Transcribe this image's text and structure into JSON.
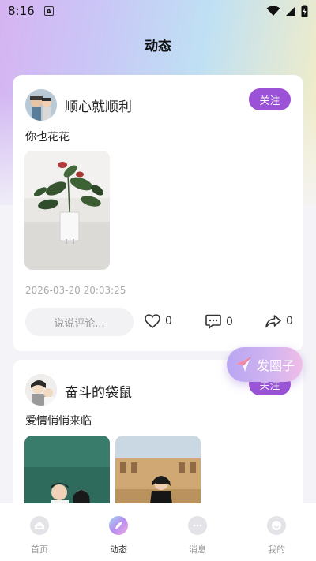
{
  "status_bar": {
    "time": "8:16",
    "indicator": "A"
  },
  "header": {
    "title": "动态"
  },
  "posts": [
    {
      "username": "顺心就顺利",
      "follow_label": "关注",
      "text": "你也花花",
      "timestamp": "2026-03-20 20:03:25",
      "comment_placeholder": "说说评论...",
      "likes": "0",
      "comments": "0",
      "shares": "0"
    },
    {
      "username": "奋斗的袋鼠",
      "follow_label": "关注",
      "text": "爱情悄悄来临"
    }
  ],
  "fab": {
    "label": "发圈子"
  },
  "tabbar": {
    "active": 1,
    "items": [
      {
        "label": "首页"
      },
      {
        "label": "动态"
      },
      {
        "label": "消息"
      },
      {
        "label": "我的"
      }
    ]
  },
  "colors": {
    "accent": "#9b52d6",
    "background": "#f4f4f8",
    "card": "#ffffff"
  }
}
